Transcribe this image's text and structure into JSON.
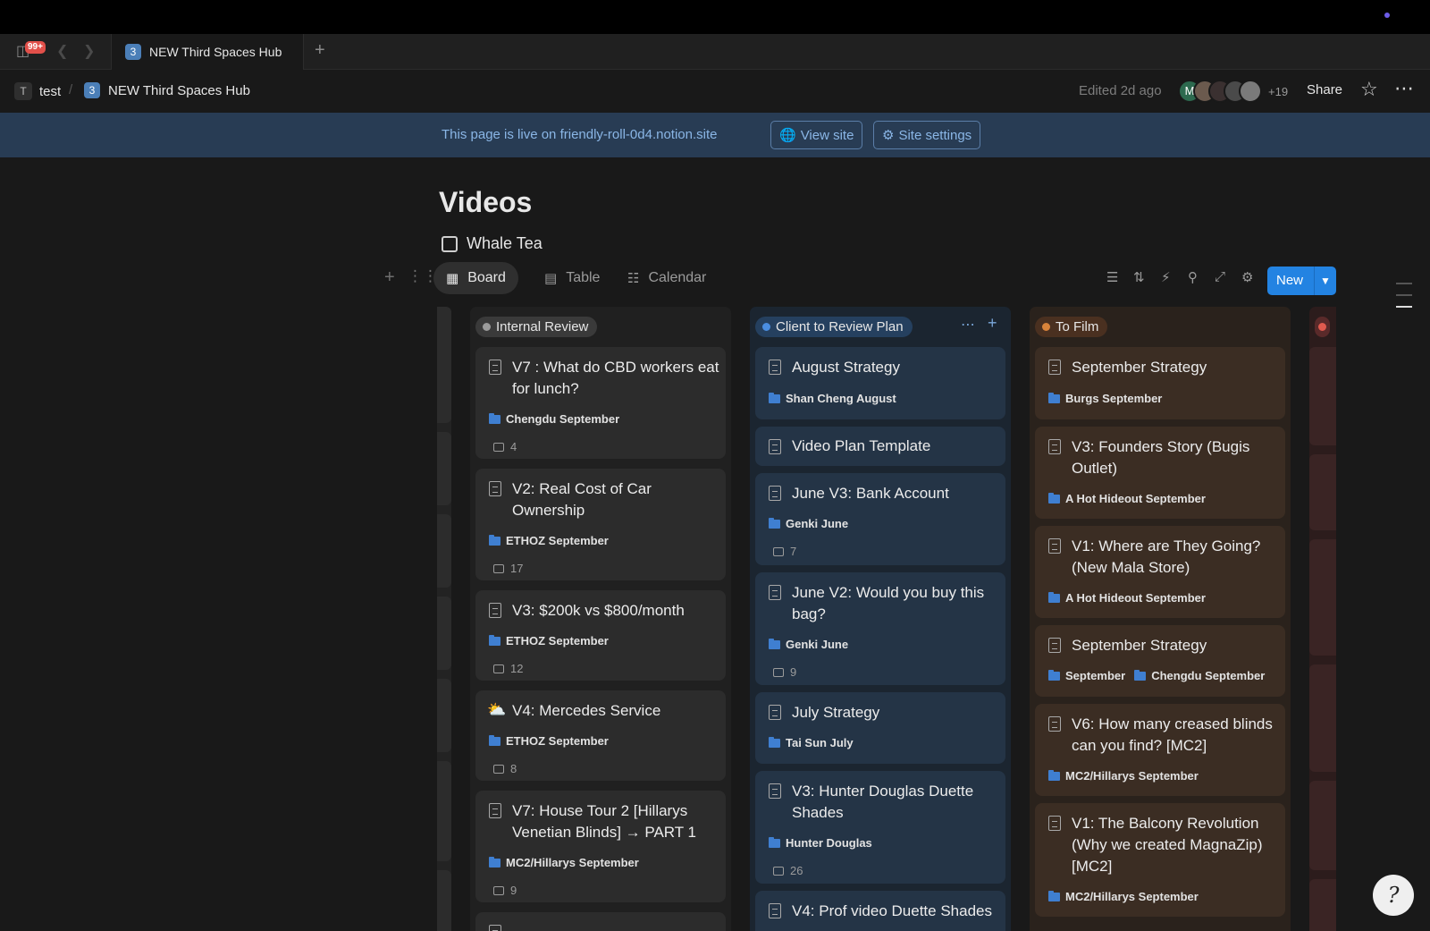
{
  "window": {
    "notification_badge": "99+",
    "tab_title": "NEW Third Spaces Hub",
    "tab_icon_text": "3"
  },
  "breadcrumb": {
    "workspace_icon": "T",
    "workspace": "test",
    "separator": "/",
    "page_icon": "3",
    "page": "NEW Third Spaces Hub"
  },
  "header": {
    "edited": "Edited 2d ago",
    "avatar_initial": "M",
    "more_collaborators": "+19",
    "share_label": "Share"
  },
  "banner": {
    "text": "This page is live on friendly-roll-0d4.notion.site",
    "view_site": "View site",
    "site_settings": "Site settings"
  },
  "page": {
    "title": "Videos",
    "linked_database": "Whale Tea"
  },
  "views": {
    "tabs": [
      {
        "label": "Board",
        "icon": "board-icon",
        "active": true
      },
      {
        "label": "Table",
        "icon": "table-icon",
        "active": false
      },
      {
        "label": "Calendar",
        "icon": "calendar-icon",
        "active": false
      }
    ],
    "new_label": "New"
  },
  "board": {
    "columns": [
      {
        "name": "Internal Review",
        "color": "#9b9b9b",
        "cards": [
          {
            "title": "V7 : What do CBD workers eat for lunch?",
            "tags": [
              "Chengdu September"
            ],
            "comments": "4"
          },
          {
            "title": "V2: Real Cost of Car Ownership",
            "tags": [
              "ETHOZ September"
            ],
            "comments": "17"
          },
          {
            "title": "V3: $200k vs $800/month",
            "tags": [
              "ETHOZ September"
            ],
            "comments": "12"
          },
          {
            "title": "V4: Mercedes Service",
            "icon": "cloud-sun-icon",
            "tags": [
              "ETHOZ September"
            ],
            "comments": "8"
          },
          {
            "title": "V7: House Tour 2 [Hillarys Venetian Blinds] → PART 1",
            "tags": [
              "MC2/Hillarys September"
            ],
            "comments": "9"
          }
        ]
      },
      {
        "name": "Client to Review Plan",
        "color": "#4a8de0",
        "cards": [
          {
            "title": "August Strategy",
            "tags": [
              "Shan Cheng August"
            ]
          },
          {
            "title": "Video Plan Template",
            "tags": []
          },
          {
            "title": "June V3: Bank Account",
            "tags": [
              "Genki June"
            ],
            "comments": "7"
          },
          {
            "title": "June V2: Would you buy this bag?",
            "tags": [
              "Genki June"
            ],
            "comments": "9"
          },
          {
            "title": "July Strategy",
            "tags": [
              "Tai Sun July"
            ]
          },
          {
            "title": "V3: Hunter Douglas Duette Shades",
            "tags": [
              "Hunter Douglas"
            ],
            "comments": "26"
          },
          {
            "title": "V4: Prof video Duette Shades",
            "tags": []
          }
        ]
      },
      {
        "name": "To Film",
        "color": "#d9833a",
        "cards": [
          {
            "title": "September Strategy",
            "tags": [
              "Burgs September"
            ]
          },
          {
            "title": "V3: Founders Story (Bugis Outlet)",
            "tags": [
              "A Hot Hideout September"
            ]
          },
          {
            "title": "V1: Where are They Going? (New Mala Store)",
            "tags": [
              "A Hot Hideout September"
            ]
          },
          {
            "title": "September Strategy",
            "tags": [
              "September",
              "Chengdu September"
            ]
          },
          {
            "title": "V6: How many creased blinds can you find? [MC2]",
            "tags": [
              "MC2/Hillarys September"
            ]
          },
          {
            "title": "V1: The Balcony Revolution (Why we created MagnaZip) [MC2]",
            "tags": [
              "MC2/Hillarys September"
            ]
          }
        ]
      }
    ],
    "next_column_color": "#e05a4e"
  },
  "help_button_glyph": "?"
}
